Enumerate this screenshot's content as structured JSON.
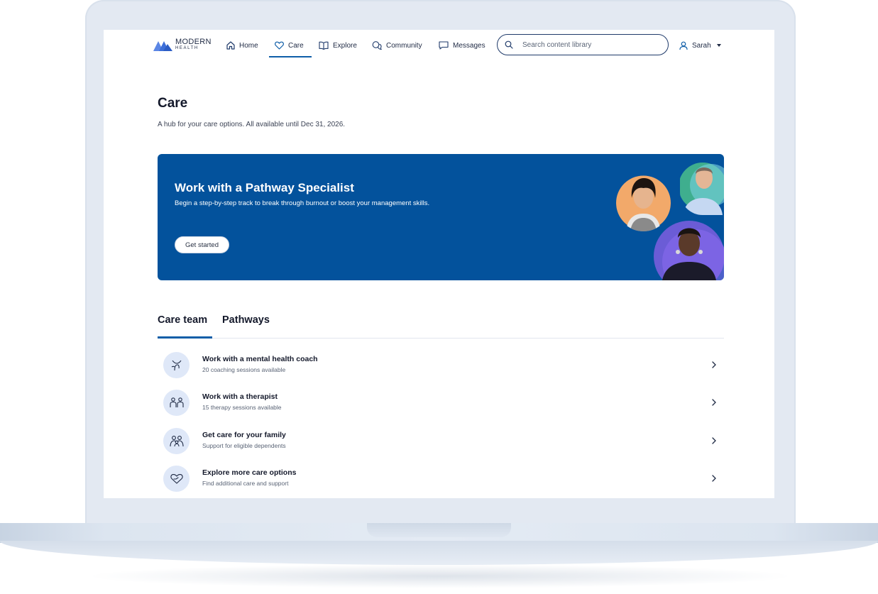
{
  "brand": {
    "line1": "MODERN",
    "line2": "HEALTH"
  },
  "nav": {
    "items": [
      {
        "label": "Home",
        "icon": "home-icon"
      },
      {
        "label": "Care",
        "icon": "heart-icon",
        "active": true
      },
      {
        "label": "Explore",
        "icon": "book-icon"
      },
      {
        "label": "Community",
        "icon": "chat-bubbles-icon"
      },
      {
        "label": "Messages",
        "icon": "message-icon"
      }
    ],
    "search_placeholder": "Search content library",
    "user_name": "Sarah"
  },
  "page": {
    "title": "Care",
    "subtitle": "A hub for your care options. All available until Dec 31, 2026."
  },
  "banner": {
    "title": "Work with a Pathway Specialist",
    "text": "Begin a step-by-step track to break through burnout or boost your management skills.",
    "button": "Get started"
  },
  "tabs": [
    {
      "label": "Care team",
      "active": true
    },
    {
      "label": "Pathways",
      "active": false
    }
  ],
  "care_items": [
    {
      "title": "Work with a mental health coach",
      "subtitle": "20 coaching sessions available",
      "icon": "coach-icon"
    },
    {
      "title": "Work with a therapist",
      "subtitle": "15 therapy sessions available",
      "icon": "therapist-icon"
    },
    {
      "title": "Get care for your family",
      "subtitle": "Support for eligible dependents",
      "icon": "family-icon"
    },
    {
      "title": "Explore more care options",
      "subtitle": "Find additional care and support",
      "icon": "heart-hand-icon"
    }
  ],
  "colors": {
    "brand_blue": "#03529c",
    "accent": "#0f5ea8",
    "icon_bg": "#dfe8f8",
    "text_dark": "#14192b"
  }
}
